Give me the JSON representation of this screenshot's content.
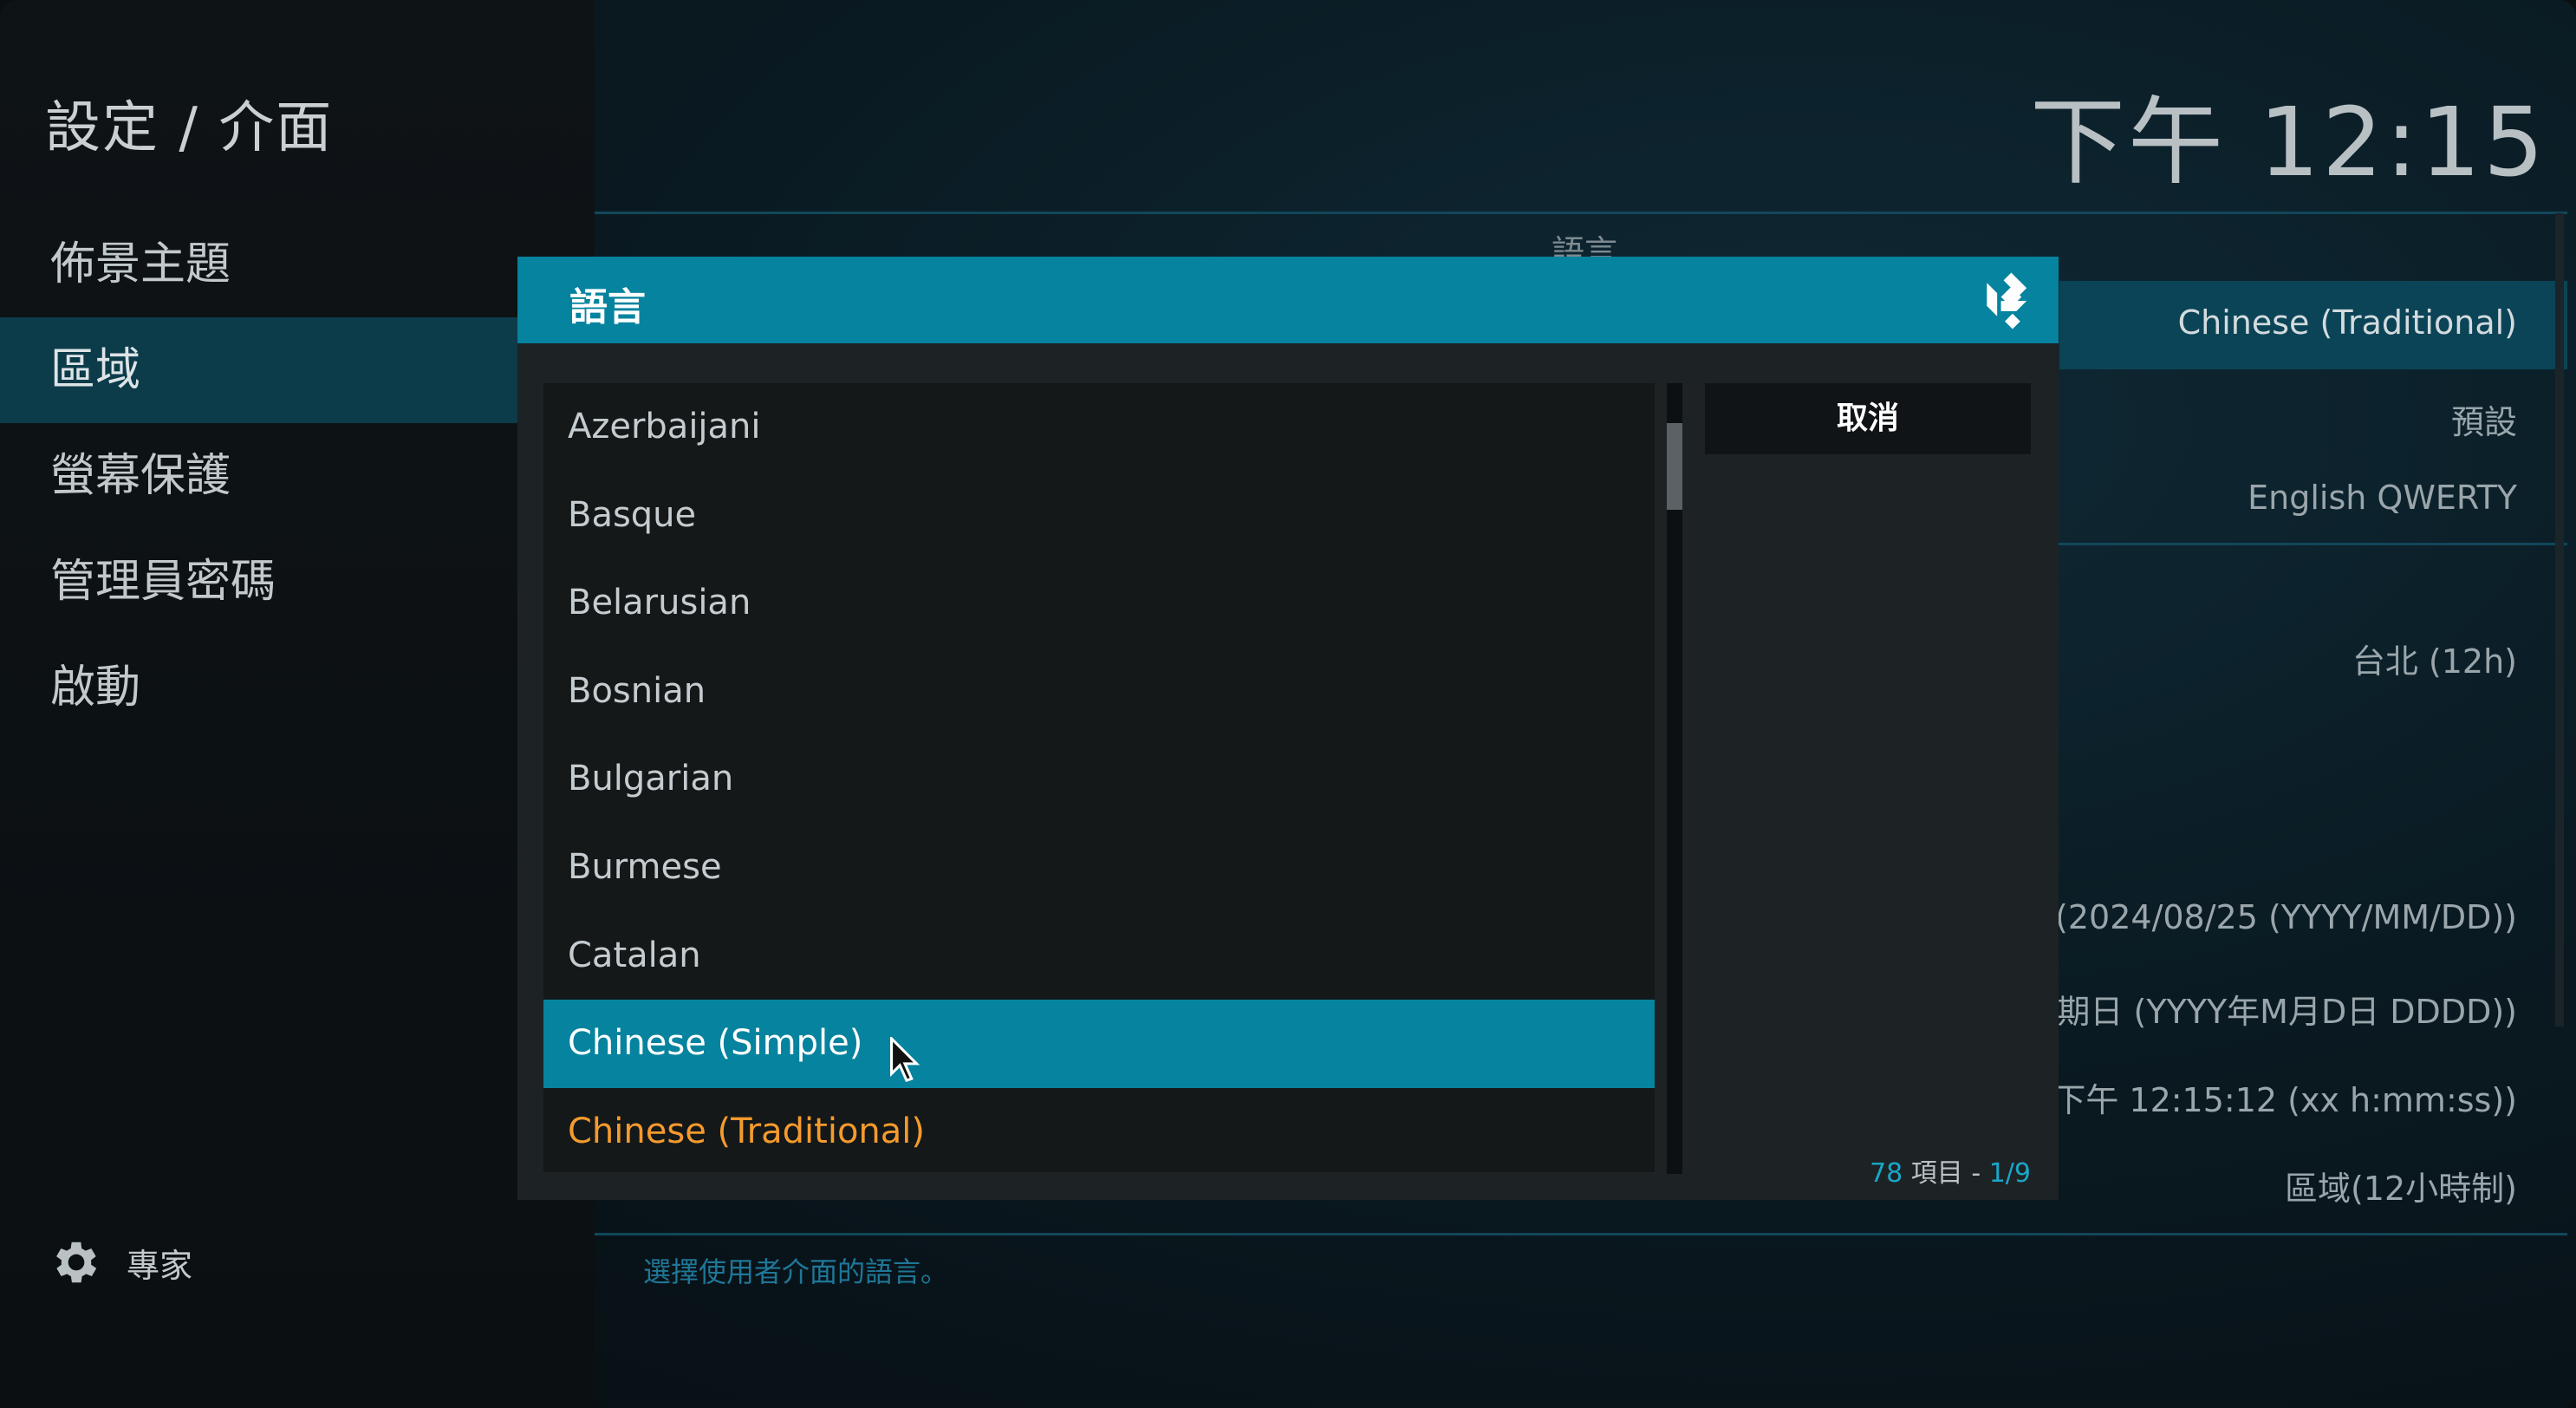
{
  "breadcrumb": "設定 / 介面",
  "clock": "下午 12:15",
  "sidebar": {
    "items": [
      {
        "label": "佈景主題",
        "active": false
      },
      {
        "label": "區域",
        "active": true
      },
      {
        "label": "螢幕保護",
        "active": false
      },
      {
        "label": "管理員密碼",
        "active": false
      },
      {
        "label": "啟動",
        "active": false
      }
    ],
    "expert_label": "專家",
    "expert_icon": "gear-icon"
  },
  "panel": {
    "section_title": "語言",
    "rows": [
      "Chinese (Traditional)",
      "預設",
      "English QWERTY",
      "台北 (12h)",
      "(2024/08/25 (YYYY/MM/DD))",
      "期日 (YYYY年M月D日 DDDD))",
      "下午 12:15:12 (xx h:mm:ss))",
      "區域(12小時制)"
    ],
    "description": "選擇使用者介面的語言。"
  },
  "dialog": {
    "title": "語言",
    "logo_icon": "kodi-logo-icon",
    "cancel_label": "取消",
    "items": [
      "Azerbaijani",
      "Basque",
      "Belarusian",
      "Bosnian",
      "Bulgarian",
      "Burmese",
      "Catalan",
      "Chinese (Simple)",
      "Chinese (Traditional)"
    ],
    "highlighted_item": "Chinese (Simple)",
    "current_item": "Chinese (Traditional)",
    "count": {
      "total": "78",
      "label": "項目 -",
      "page": "1/9"
    },
    "scroll_position": 0.05,
    "scroll_fraction": 0.11
  },
  "colors": {
    "accent": "#06839e",
    "current": "#f59a2d",
    "count_number": "#19a6c8"
  }
}
